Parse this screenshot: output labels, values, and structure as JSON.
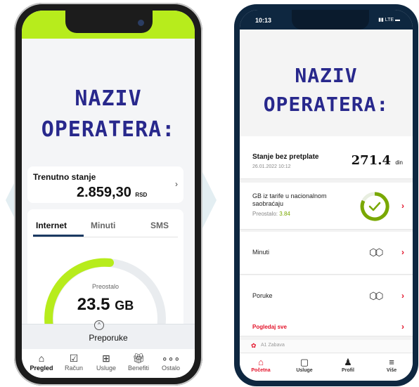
{
  "left_phone": {
    "operator_title_line1": "NAZIV",
    "operator_title_line2": "OPERATERA:",
    "balance_label": "Trenutno stanje",
    "balance_amount": "2.859,30",
    "balance_currency": "RSD",
    "tabs": [
      {
        "label": "Internet",
        "active": true
      },
      {
        "label": "Minuti",
        "active": false
      },
      {
        "label": "SMS",
        "active": false
      }
    ],
    "remaining_label": "Preostalo",
    "remaining_amount": "23.5",
    "remaining_unit": "GB",
    "recommendations_label": "Preporuke",
    "nav": [
      {
        "label": "Pregled",
        "icon": "home-icon",
        "active": true
      },
      {
        "label": "Račun",
        "icon": "bill-icon",
        "active": false
      },
      {
        "label": "Usluge",
        "icon": "grid-icon",
        "active": false
      },
      {
        "label": "Benefiti",
        "icon": "gift-icon",
        "active": false
      },
      {
        "label": "Ostalo",
        "icon": "more-icon",
        "active": false
      }
    ],
    "accent_color": "#b7ec1c"
  },
  "right_phone": {
    "status_time": "10:13",
    "status_network": "LTE",
    "operator_title_line1": "NAZIV",
    "operator_title_line2": "OPERATERA:",
    "balance_title": "Stanje bez pretplate",
    "balance_date": "26.01.2022 10:12",
    "balance_amount": "271.4",
    "balance_unit": "din",
    "gb_title": "GB iz tarife u nacionalnom saobraćaju",
    "gb_remaining_label": "Preostalo:",
    "gb_remaining_value": "3.84",
    "minutes_label": "Minuti",
    "messages_label": "Poruke",
    "see_all_label": "Pogledaj sve",
    "promo_label": "A1 Zabava",
    "nav": [
      {
        "label": "Početna",
        "icon": "home-icon",
        "active": true
      },
      {
        "label": "Usluge",
        "icon": "services-icon",
        "active": false
      },
      {
        "label": "Profil",
        "icon": "profile-icon",
        "active": false
      },
      {
        "label": "Više",
        "icon": "menu-icon",
        "active": false
      }
    ],
    "accent_color": "#e3132a"
  }
}
